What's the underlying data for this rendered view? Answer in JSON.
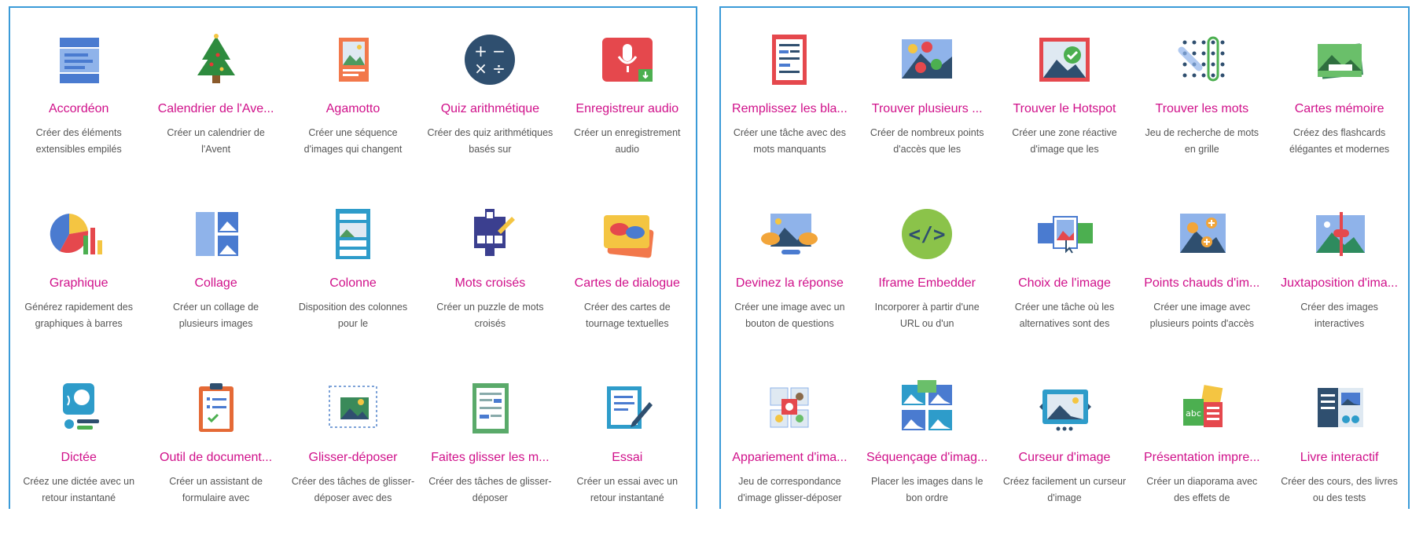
{
  "left_panel": {
    "cards": [
      {
        "icon": "accordion-icon",
        "title": "Accordéon",
        "desc": "Créer des éléments extensibles empilés"
      },
      {
        "icon": "christmas-tree-icon",
        "title": "Calendrier de l'Ave...",
        "desc": "Créer un calendrier de l'Avent"
      },
      {
        "icon": "picture-frame-icon",
        "title": "Agamotto",
        "desc": "Créer une séquence d'images qui changent"
      },
      {
        "icon": "arithmetic-icon",
        "title": "Quiz arithmétique",
        "desc": "Créer des quiz arithmétiques basés sur"
      },
      {
        "icon": "microphone-icon",
        "title": "Enregistreur audio",
        "desc": "Créer un enregistrement audio"
      },
      {
        "icon": "chart-icon",
        "title": "Graphique",
        "desc": "Générez rapidement des graphiques à barres"
      },
      {
        "icon": "collage-icon",
        "title": "Collage",
        "desc": "Créer un collage de plusieurs images"
      },
      {
        "icon": "column-icon",
        "title": "Colonne",
        "desc": "Disposition des colonnes pour le"
      },
      {
        "icon": "crossword-icon",
        "title": "Mots croisés",
        "desc": "Créer un puzzle de mots croisés"
      },
      {
        "icon": "dialog-cards-icon",
        "title": "Cartes de dialogue",
        "desc": "Créer des cartes de tournage textuelles"
      },
      {
        "icon": "dictation-icon",
        "title": "Dictée",
        "desc": "Créez une dictée avec un retour instantané"
      },
      {
        "icon": "clipboard-icon",
        "title": "Outil de document...",
        "desc": "Créer un assistant de formulaire avec"
      },
      {
        "icon": "drag-drop-icon",
        "title": "Glisser-déposer",
        "desc": "Créer des tâches de glisser-déposer avec des"
      },
      {
        "icon": "drag-text-icon",
        "title": "Faites glisser les m...",
        "desc": "Créer des tâches de glisser-déposer"
      },
      {
        "icon": "essay-icon",
        "title": "Essai",
        "desc": "Créer un essai avec un retour instantané"
      }
    ]
  },
  "right_panel": {
    "cards": [
      {
        "icon": "fill-blanks-icon",
        "title": "Remplissez les bla...",
        "desc": "Créer une tâche avec des mots manquants"
      },
      {
        "icon": "multi-hotspot-icon",
        "title": "Trouver plusieurs ...",
        "desc": "Créer de nombreux points d'accès que les"
      },
      {
        "icon": "hotspot-icon",
        "title": "Trouver le Hotspot",
        "desc": "Créer une zone réactive d'image que les"
      },
      {
        "icon": "word-search-icon",
        "title": "Trouver les mots",
        "desc": "Jeu de recherche de mots en grille"
      },
      {
        "icon": "flashcards-icon",
        "title": "Cartes mémoire",
        "desc": "Créez des flashcards élégantes et modernes"
      },
      {
        "icon": "guess-answer-icon",
        "title": "Devinez la réponse",
        "desc": "Créer une image avec un bouton de questions"
      },
      {
        "icon": "code-icon",
        "title": "Iframe Embedder",
        "desc": "Incorporer à partir d'une URL ou d'un"
      },
      {
        "icon": "image-choice-icon",
        "title": "Choix de l'image",
        "desc": "Créer une tâche où les alternatives sont des"
      },
      {
        "icon": "image-hotspots-icon",
        "title": "Points chauds d'im...",
        "desc": "Créer une image avec plusieurs points d'accès"
      },
      {
        "icon": "juxtaposition-icon",
        "title": "Juxtaposition d'ima...",
        "desc": "Créer des images interactives"
      },
      {
        "icon": "image-pairing-icon",
        "title": "Appariement d'ima...",
        "desc": "Jeu de correspondance d'image glisser-déposer"
      },
      {
        "icon": "image-sequencing-icon",
        "title": "Séquençage d'imag...",
        "desc": "Placer les images dans le bon ordre"
      },
      {
        "icon": "image-slider-icon",
        "title": "Curseur d'image",
        "desc": "Créez facilement un curseur d'image"
      },
      {
        "icon": "presentation-icon",
        "title": "Présentation impre...",
        "desc": "Créer un diaporama avec des effets de"
      },
      {
        "icon": "interactive-book-icon",
        "title": "Livre interactif",
        "desc": "Créer des cours, des livres ou des tests"
      }
    ]
  },
  "colors": {
    "title": "#d0108a",
    "border": "#3b9bd8",
    "desc": "#555555"
  }
}
